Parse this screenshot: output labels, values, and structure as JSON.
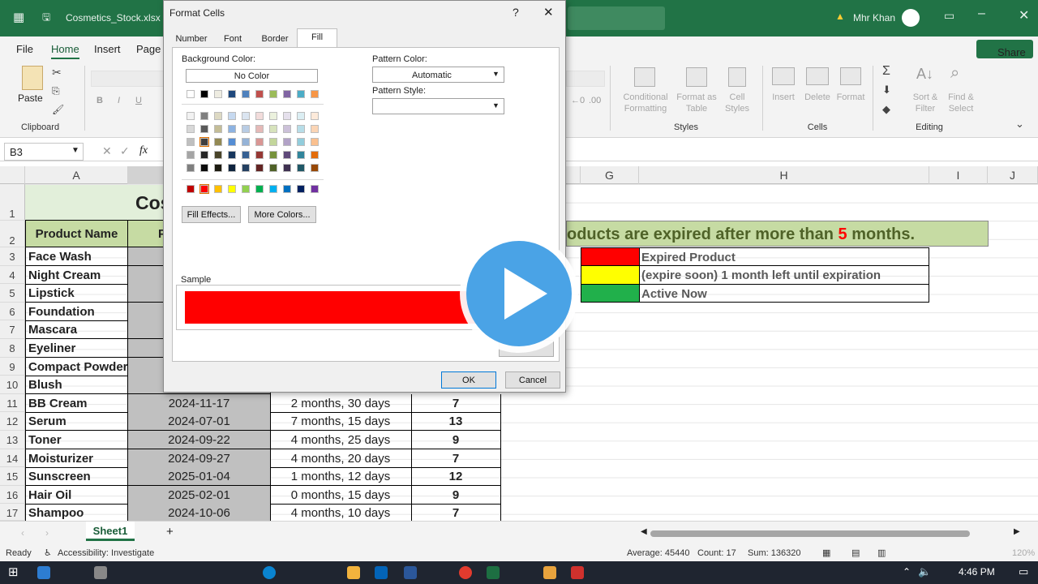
{
  "window": {
    "filename": "Cosmetics_Stock.xlsx",
    "user": "Mhr Khan"
  },
  "menu": {
    "items": [
      "File",
      "Home",
      "Insert",
      "Page"
    ],
    "share": "Share"
  },
  "ribbon": {
    "paste": "Paste",
    "clipboard": "Clipboard",
    "styles": {
      "conditional": "Conditional\nFormatting",
      "format_table": "Format as\nTable",
      "cell_styles": "Cell\nStyles",
      "label": "Styles"
    },
    "cells": {
      "insert": "Insert",
      "delete": "Delete",
      "format": "Format",
      "label": "Cells"
    },
    "editing": {
      "sort": "Sort &\nFilter",
      "find": "Find &\nSelect",
      "label": "Editing"
    }
  },
  "formula_bar": {
    "name_box": "B3",
    "fx": "fx"
  },
  "columns": [
    "A",
    "G",
    "H",
    "I",
    "J"
  ],
  "rows": [
    "1",
    "2",
    "3",
    "4",
    "5",
    "6",
    "7",
    "8",
    "9",
    "10",
    "11",
    "12",
    "13",
    "14",
    "15",
    "16",
    "17"
  ],
  "sheet": {
    "title_partial": "Cos",
    "header_product": "Product Name",
    "header_b_partial": "P",
    "banner_pre": "oducts are expired after more than ",
    "banner_num": "5",
    "banner_post": " months.",
    "products": [
      "Face Wash",
      "Night Cream",
      "Lipstick",
      "Foundation",
      "Mascara",
      "Eyeliner",
      "Compact Powder",
      "Blush",
      "BB Cream",
      "Serum",
      "Toner",
      "Moisturizer",
      "Sunscreen",
      "Hair Oil",
      "Shampoo"
    ],
    "visible_rows": [
      {
        "date": "2024-11-17",
        "remaining": "2 months, 30 days",
        "num": "7"
      },
      {
        "date": "2024-07-01",
        "remaining": "7 months, 15 days",
        "num": "13"
      },
      {
        "date": "2024-09-22",
        "remaining": "4 months, 25 days",
        "num": "9"
      },
      {
        "date": "2024-09-27",
        "remaining": "4 months, 20 days",
        "num": "7"
      },
      {
        "date": "2025-01-04",
        "remaining": "1 months, 12 days",
        "num": "12"
      },
      {
        "date": "2025-02-01",
        "remaining": "0 months, 15 days",
        "num": "9"
      },
      {
        "date": "2024-10-06",
        "remaining": "4 months, 10 days",
        "num": "7"
      }
    ],
    "legend": [
      {
        "color": "#ff0000",
        "text": "Expired Product"
      },
      {
        "color": "#ffff00",
        "text": "(expire soon) 1 month left until expiration"
      },
      {
        "color": "#21b04b",
        "text": "Active Now"
      }
    ]
  },
  "sheet_tab": "Sheet1",
  "status": {
    "ready": "Ready",
    "accessibility": "Accessibility: Investigate",
    "average": "Average: 45440",
    "count": "Count: 17",
    "sum": "Sum: 136320",
    "zoom": "120%"
  },
  "taskbar": {
    "time": "4:46 PM"
  },
  "dialog": {
    "title": "Format Cells",
    "help": "?",
    "tabs": [
      "Number",
      "Font",
      "Border",
      "Fill"
    ],
    "active_tab": "Fill",
    "background_color": "Background Color:",
    "no_color": "No Color",
    "pattern_color_label": "Pattern Color:",
    "pattern_color_value": "Automatic",
    "pattern_style_label": "Pattern Style:",
    "fill_effects": "Fill Effects...",
    "more_colors": "More Colors...",
    "sample": "Sample",
    "sample_color": "#ff0000",
    "ok": "OK",
    "cancel": "Cancel"
  },
  "colors": {
    "excel_green": "#217346",
    "banner_bg": "#c6dba3",
    "banner_text": "#4f6228",
    "header_bg": "#c6dba3",
    "title_bg": "#e2efda",
    "date_bg": "#c0c0c0",
    "play": "#4aa3e6"
  }
}
